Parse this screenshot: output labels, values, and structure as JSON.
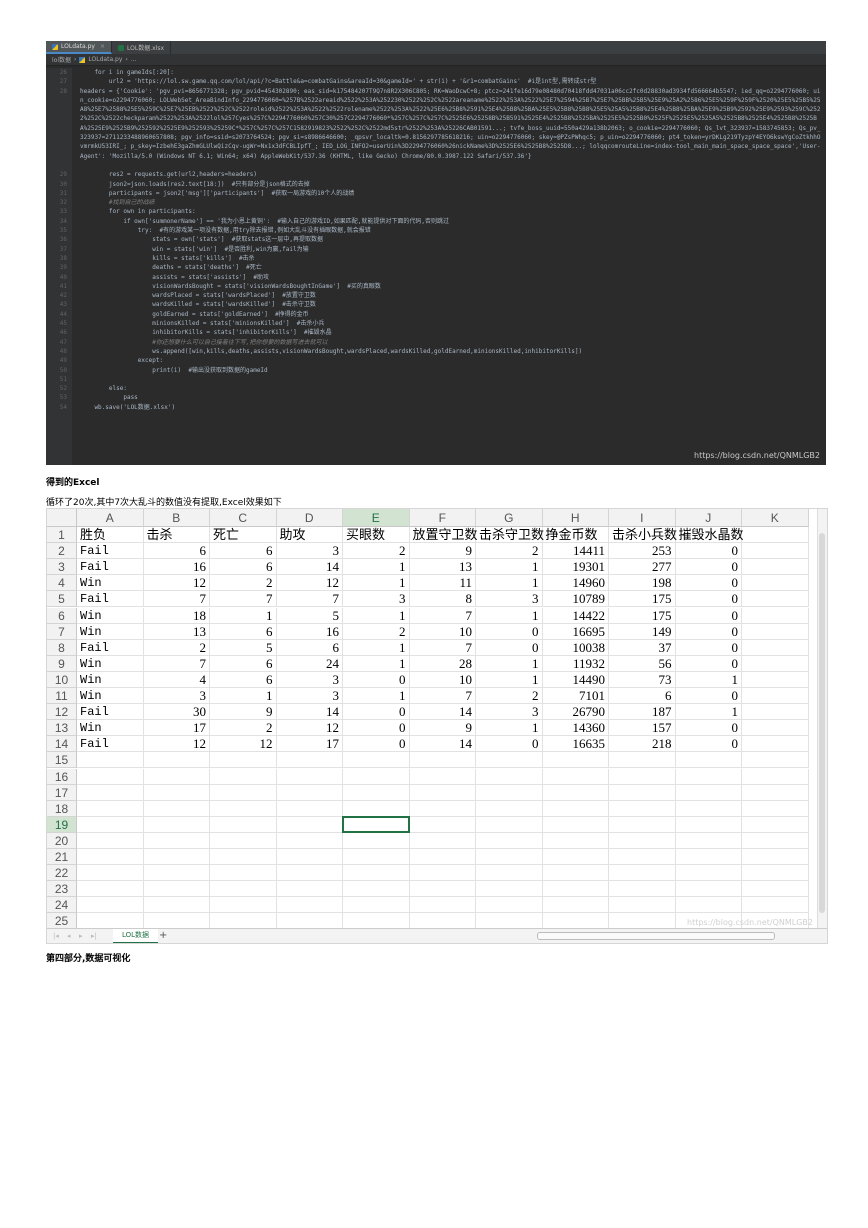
{
  "editor": {
    "tabs": [
      {
        "label": "LOLdata.py",
        "close": "×"
      },
      {
        "label": "LOL数据.xlsx"
      }
    ],
    "breadcrumb": [
      "lol数据",
      "LOLdata.py",
      "..."
    ],
    "line_numbers": [
      "26",
      "27",
      "28",
      "",
      "",
      "",
      "",
      "",
      "",
      "",
      "",
      "29",
      "30",
      "31",
      "32",
      "33",
      "34",
      "35",
      "36",
      "37",
      "38",
      "39",
      "40",
      "41",
      "42",
      "43",
      "44",
      "45",
      "46",
      "47",
      "48",
      "49",
      "50",
      "51",
      "52",
      "53",
      "54"
    ],
    "lines": [
      "    for i in gameIds[:20]:",
      "        url2 = 'https://lol.sw.game.qq.com/lol/api/?c=Battle&a=combatGains&areaId=30&gameId=' + str(i) + '&r1=combatGains'  #i是int型,需转成str型",
      "        headers = {'Cookie': 'pgv_pvi=8656771328; pgv_pvid=454302890; eas_sid=k175484207T9Q7n8R2X306C805; RK=WaoDcwC+8; ptcz=241fe16d79e08480d70418fdd47031a06cc2fc0d28830ad3934fd566664b5547; ied_qq=o2294776060; uin_cookie=o2294776060; LOLWebSet_AreaBindInfo_2294776060=%257B%2522areaid%2522%253A%252230%2522%252C%2522areaname%2522%253A%2522%25E7%2594%25B7%25E7%25BB%25B5%25E9%25A2%2586%25E5%259F%259F%2520%25E5%25B5%25A8%25E7%2588%25E5%259C%25E7%25EB%2522%252C%2522roleid%2522%253A%2522%2522rolename%2522%253A%2522%25E6%25B8%2591%25E4%25B8%25BA%25E5%25B8%25B8%25E5%25A5%25B8%25E4%25B8%25BA%25E9%25B9%2592%25E9%2593%259C%2522%252C%2522checkparam%2522%253A%2522lol%257Cyes%257C%2294776060%257C30%257C2294776060*%257C%257C%257C%2525E6%25258B%25B591%2525E4%2525B8%2525BA%2525E5%2525B0%2525F%2525E5%2525A5%2525B8%2525E4%2525B8%2525BA%2525E9%2525B9%252592%2525E9%252593%25259C*%257C%257C%257C1582919823%2522%252C%2522md5str%2522%253A%25226CAB01591...; tvfe_boss_uuid=550a429a138b2063; o_cookie=2294776060; Qs_lvt_323937=1583745853; Qs_pv_323937=2711233488960657808; pgv_info=ssid=s2073764524; pgv_si=s8986646600; _qpsvr_localtk=0.8156297785618216; uin=o2294776060; skey=@PZsPWhqc5; p_uin=o2294776060; pt4_token=yrDKLg219TyzpY4EYO6kswYgCoZtkhhOvmrmkU53IRI_; p_skey=IzbehE3gaZhmGLUlwQizCqv-ugWr=Nx1x3dFCBLIpfT_; IED_LOG_INFO2=userUin%3D2294776060%26nickName%3D%2525E6%2525B8%2525D8...; lolqqcomrouteLine=index-tool_main_main_space_space_space','User-Agent': 'Mozilla/5.0 (Windows NT 6.1; Win64; x64) AppleWebKit/537.36 (KHTML, like Gecko) Chrome/80.0.3987.122 Safari/537.36'}",
      "        res2 = requests.get(url2,headers=headers)",
      "        json2=json.loads(res2.text[18:])  #只有部分是json格式的去掉",
      "        participants = json2['msg']['participants']  #获取一局游戏的10个人的战绩",
      "        #找到自己的战绩",
      "        for own in participants:",
      "            if own['summonerName'] == '我为小恩上黄铜':  #输入自己的游戏ID,如果匹配,就能提供对下面的代码,否则跳过",
      "                try:  #有的游戏某一项没有数据,用try除去报错,例如大乱斗没有插眼数据,就会报错",
      "                    stats = own['stats']  #获取stats这一层中,再提取数据",
      "                    win = stats['win']  #是否胜利,win为赢,fail为输",
      "                    kills = stats['kills']  #击杀",
      "                    deaths = stats['deaths']  #死亡",
      "                    assists = stats['assists']  #助攻",
      "                    visionWardsBought = stats['visionWardsBoughtInGame']  #买的真眼数",
      "                    wardsPlaced = stats['wardsPlaced']  #放置守卫数",
      "                    wardsKilled = stats['wardsKilled']  #击杀守卫数",
      "                    goldEarned = stats['goldEarned']  #挣得的金币",
      "                    minionsKilled = stats['minionsKilled']  #击杀小兵",
      "                    inhibitorKills = stats['inhibitorKills']  #摧毁水晶",
      "                    #你还想要什么可以自己接着往下写,把你想要的数据写进去就可以",
      "                    ws.append([win,kills,deaths,assists,visionWardsBought,wardsPlaced,wardsKilled,goldEarned,minionsKilled,inhibitorKills])",
      "                except:",
      "                    print(i)  #输出没获取到数据的gameId",
      "",
      "        else:",
      "            pass",
      "    wb.save('LOL数据.xlsx')"
    ],
    "watermark": "https://blog.csdn.net/QNMLGB2"
  },
  "texts": {
    "heading1": "得到的Excel",
    "para1": "循环了20次,其中7次大乱斗的数值没有提取,Excel效果如下",
    "heading2": "第四部分,数据可视化"
  },
  "sheet": {
    "columns": [
      "A",
      "B",
      "C",
      "D",
      "E",
      "F",
      "G",
      "H",
      "I",
      "J",
      "K"
    ],
    "selected_column": "E",
    "selected_row": "19",
    "row_numbers": [
      "1",
      "2",
      "3",
      "4",
      "5",
      "6",
      "7",
      "8",
      "9",
      "10",
      "11",
      "12",
      "13",
      "14",
      "15",
      "16",
      "17",
      "18",
      "19",
      "20",
      "21",
      "22",
      "23",
      "24",
      "25"
    ],
    "headers": [
      "胜负",
      "击杀",
      "死亡",
      "助攻",
      "买眼数",
      "放置守卫数",
      "击杀守卫数",
      "挣金币数",
      "击杀小兵数",
      "摧毁水晶数"
    ],
    "rows": [
      [
        "Fail",
        "6",
        "6",
        "3",
        "2",
        "9",
        "2",
        "14411",
        "253",
        "0"
      ],
      [
        "Fail",
        "16",
        "6",
        "14",
        "1",
        "13",
        "1",
        "19301",
        "277",
        "0"
      ],
      [
        "Win",
        "12",
        "2",
        "12",
        "1",
        "11",
        "1",
        "14960",
        "198",
        "0"
      ],
      [
        "Fail",
        "7",
        "7",
        "7",
        "3",
        "8",
        "3",
        "10789",
        "175",
        "0"
      ],
      [
        "Win",
        "18",
        "1",
        "5",
        "1",
        "7",
        "1",
        "14422",
        "175",
        "0"
      ],
      [
        "Win",
        "13",
        "6",
        "16",
        "2",
        "10",
        "0",
        "16695",
        "149",
        "0"
      ],
      [
        "Fail",
        "2",
        "5",
        "6",
        "1",
        "7",
        "0",
        "10038",
        "37",
        "0"
      ],
      [
        "Win",
        "7",
        "6",
        "24",
        "1",
        "28",
        "1",
        "11932",
        "56",
        "0"
      ],
      [
        "Win",
        "4",
        "6",
        "3",
        "0",
        "10",
        "1",
        "14490",
        "73",
        "1"
      ],
      [
        "Win",
        "3",
        "1",
        "3",
        "1",
        "7",
        "2",
        "7101",
        "6",
        "0"
      ],
      [
        "Fail",
        "30",
        "9",
        "14",
        "0",
        "14",
        "3",
        "26790",
        "187",
        "1"
      ],
      [
        "Win",
        "17",
        "2",
        "12",
        "0",
        "9",
        "1",
        "14360",
        "157",
        "0"
      ],
      [
        "Fail",
        "12",
        "12",
        "17",
        "0",
        "14",
        "0",
        "16635",
        "218",
        "0"
      ]
    ],
    "sheet_tab": "LOL数据",
    "add_sheet": "+",
    "watermark": "https://blog.csdn.net/QNMLGB2"
  }
}
